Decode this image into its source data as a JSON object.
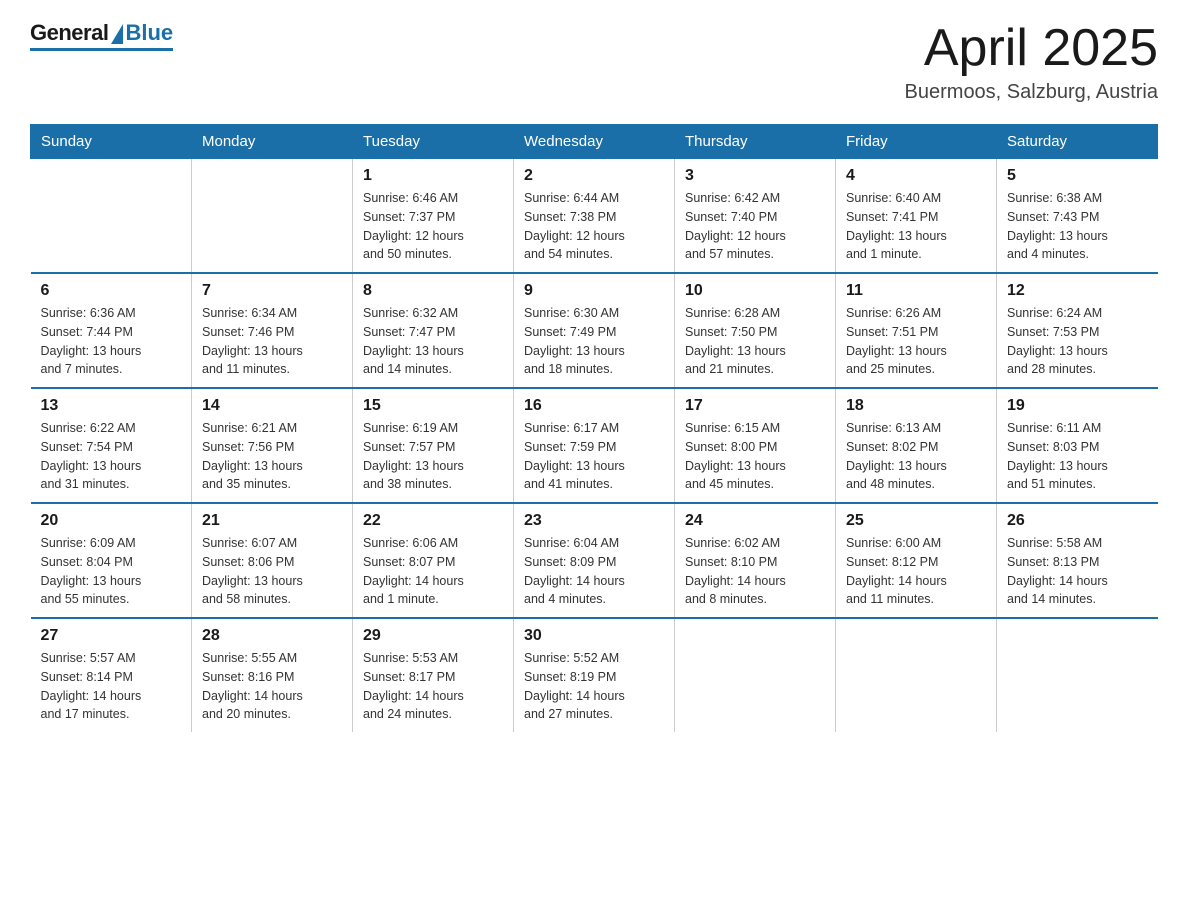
{
  "header": {
    "logo_general": "General",
    "logo_blue": "Blue",
    "month_title": "April 2025",
    "location": "Buermoos, Salzburg, Austria"
  },
  "columns": [
    "Sunday",
    "Monday",
    "Tuesday",
    "Wednesday",
    "Thursday",
    "Friday",
    "Saturday"
  ],
  "weeks": [
    [
      {
        "day": "",
        "info": ""
      },
      {
        "day": "",
        "info": ""
      },
      {
        "day": "1",
        "info": "Sunrise: 6:46 AM\nSunset: 7:37 PM\nDaylight: 12 hours\nand 50 minutes."
      },
      {
        "day": "2",
        "info": "Sunrise: 6:44 AM\nSunset: 7:38 PM\nDaylight: 12 hours\nand 54 minutes."
      },
      {
        "day": "3",
        "info": "Sunrise: 6:42 AM\nSunset: 7:40 PM\nDaylight: 12 hours\nand 57 minutes."
      },
      {
        "day": "4",
        "info": "Sunrise: 6:40 AM\nSunset: 7:41 PM\nDaylight: 13 hours\nand 1 minute."
      },
      {
        "day": "5",
        "info": "Sunrise: 6:38 AM\nSunset: 7:43 PM\nDaylight: 13 hours\nand 4 minutes."
      }
    ],
    [
      {
        "day": "6",
        "info": "Sunrise: 6:36 AM\nSunset: 7:44 PM\nDaylight: 13 hours\nand 7 minutes."
      },
      {
        "day": "7",
        "info": "Sunrise: 6:34 AM\nSunset: 7:46 PM\nDaylight: 13 hours\nand 11 minutes."
      },
      {
        "day": "8",
        "info": "Sunrise: 6:32 AM\nSunset: 7:47 PM\nDaylight: 13 hours\nand 14 minutes."
      },
      {
        "day": "9",
        "info": "Sunrise: 6:30 AM\nSunset: 7:49 PM\nDaylight: 13 hours\nand 18 minutes."
      },
      {
        "day": "10",
        "info": "Sunrise: 6:28 AM\nSunset: 7:50 PM\nDaylight: 13 hours\nand 21 minutes."
      },
      {
        "day": "11",
        "info": "Sunrise: 6:26 AM\nSunset: 7:51 PM\nDaylight: 13 hours\nand 25 minutes."
      },
      {
        "day": "12",
        "info": "Sunrise: 6:24 AM\nSunset: 7:53 PM\nDaylight: 13 hours\nand 28 minutes."
      }
    ],
    [
      {
        "day": "13",
        "info": "Sunrise: 6:22 AM\nSunset: 7:54 PM\nDaylight: 13 hours\nand 31 minutes."
      },
      {
        "day": "14",
        "info": "Sunrise: 6:21 AM\nSunset: 7:56 PM\nDaylight: 13 hours\nand 35 minutes."
      },
      {
        "day": "15",
        "info": "Sunrise: 6:19 AM\nSunset: 7:57 PM\nDaylight: 13 hours\nand 38 minutes."
      },
      {
        "day": "16",
        "info": "Sunrise: 6:17 AM\nSunset: 7:59 PM\nDaylight: 13 hours\nand 41 minutes."
      },
      {
        "day": "17",
        "info": "Sunrise: 6:15 AM\nSunset: 8:00 PM\nDaylight: 13 hours\nand 45 minutes."
      },
      {
        "day": "18",
        "info": "Sunrise: 6:13 AM\nSunset: 8:02 PM\nDaylight: 13 hours\nand 48 minutes."
      },
      {
        "day": "19",
        "info": "Sunrise: 6:11 AM\nSunset: 8:03 PM\nDaylight: 13 hours\nand 51 minutes."
      }
    ],
    [
      {
        "day": "20",
        "info": "Sunrise: 6:09 AM\nSunset: 8:04 PM\nDaylight: 13 hours\nand 55 minutes."
      },
      {
        "day": "21",
        "info": "Sunrise: 6:07 AM\nSunset: 8:06 PM\nDaylight: 13 hours\nand 58 minutes."
      },
      {
        "day": "22",
        "info": "Sunrise: 6:06 AM\nSunset: 8:07 PM\nDaylight: 14 hours\nand 1 minute."
      },
      {
        "day": "23",
        "info": "Sunrise: 6:04 AM\nSunset: 8:09 PM\nDaylight: 14 hours\nand 4 minutes."
      },
      {
        "day": "24",
        "info": "Sunrise: 6:02 AM\nSunset: 8:10 PM\nDaylight: 14 hours\nand 8 minutes."
      },
      {
        "day": "25",
        "info": "Sunrise: 6:00 AM\nSunset: 8:12 PM\nDaylight: 14 hours\nand 11 minutes."
      },
      {
        "day": "26",
        "info": "Sunrise: 5:58 AM\nSunset: 8:13 PM\nDaylight: 14 hours\nand 14 minutes."
      }
    ],
    [
      {
        "day": "27",
        "info": "Sunrise: 5:57 AM\nSunset: 8:14 PM\nDaylight: 14 hours\nand 17 minutes."
      },
      {
        "day": "28",
        "info": "Sunrise: 5:55 AM\nSunset: 8:16 PM\nDaylight: 14 hours\nand 20 minutes."
      },
      {
        "day": "29",
        "info": "Sunrise: 5:53 AM\nSunset: 8:17 PM\nDaylight: 14 hours\nand 24 minutes."
      },
      {
        "day": "30",
        "info": "Sunrise: 5:52 AM\nSunset: 8:19 PM\nDaylight: 14 hours\nand 27 minutes."
      },
      {
        "day": "",
        "info": ""
      },
      {
        "day": "",
        "info": ""
      },
      {
        "day": "",
        "info": ""
      }
    ]
  ]
}
